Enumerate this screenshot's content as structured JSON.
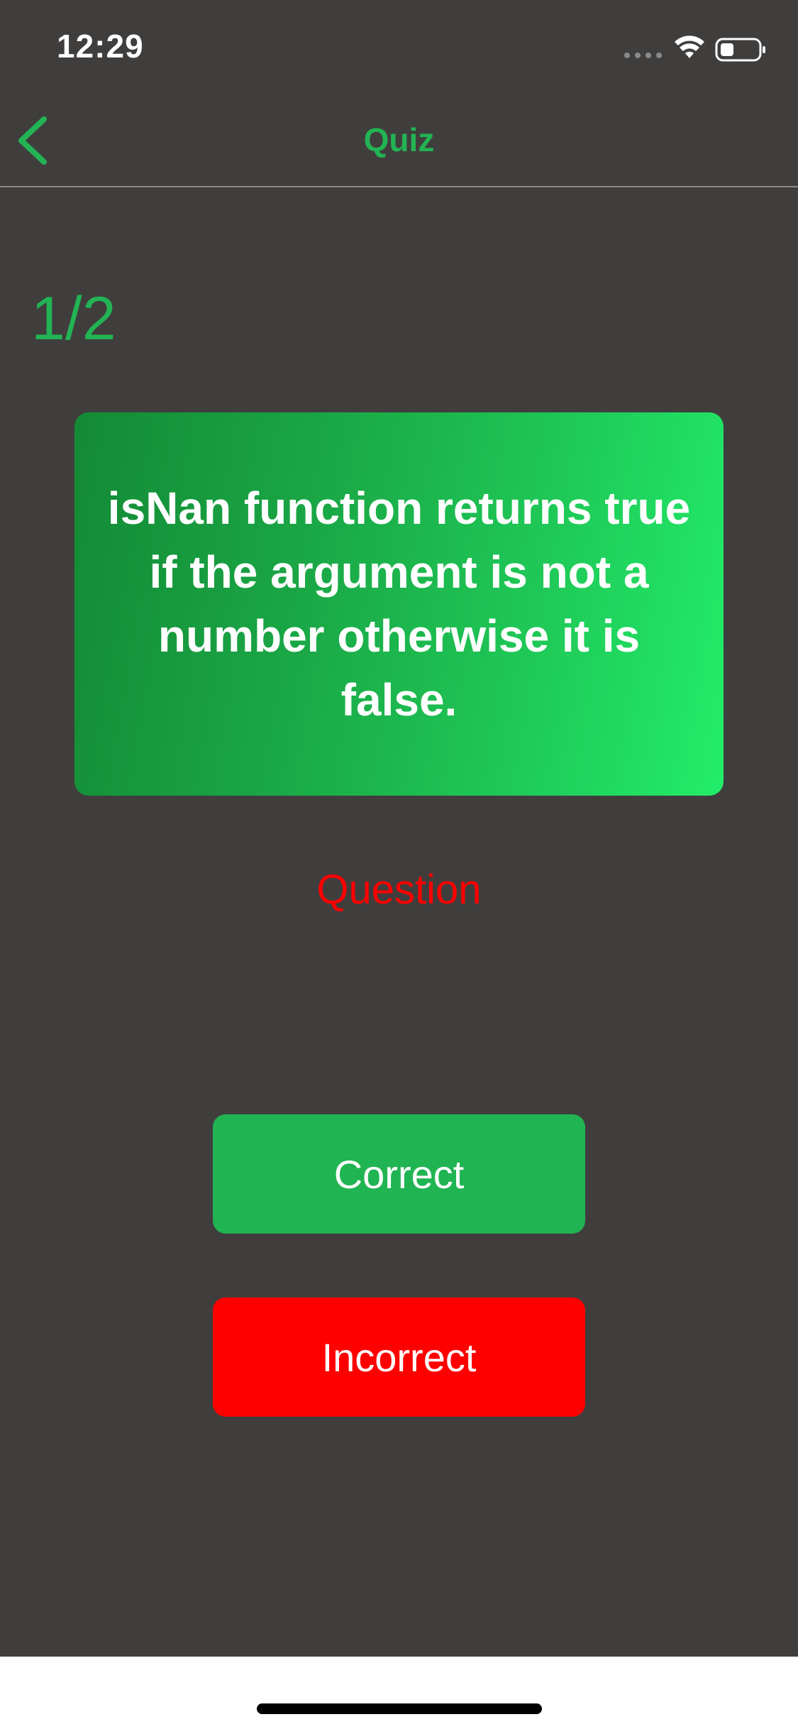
{
  "status_bar": {
    "time": "12:29",
    "icons": [
      "signal-dots-icon",
      "wifi-icon",
      "battery-icon"
    ]
  },
  "nav": {
    "back_icon": "chevron-left-icon",
    "title": "Quiz"
  },
  "quiz": {
    "progress": "1/2",
    "question_text": "isNan function returns true if the argument is not a number otherwise it is false.",
    "card_side_label": "Question"
  },
  "answers": {
    "correct_label": "Correct",
    "incorrect_label": "Incorrect"
  },
  "colors": {
    "background": "#403e3d",
    "accent_green": "#22b454",
    "card_gradient_start": "#138a35",
    "card_gradient_end": "#22ed6a",
    "incorrect_red": "#ff0000",
    "question_label_red": "#ff0000"
  }
}
